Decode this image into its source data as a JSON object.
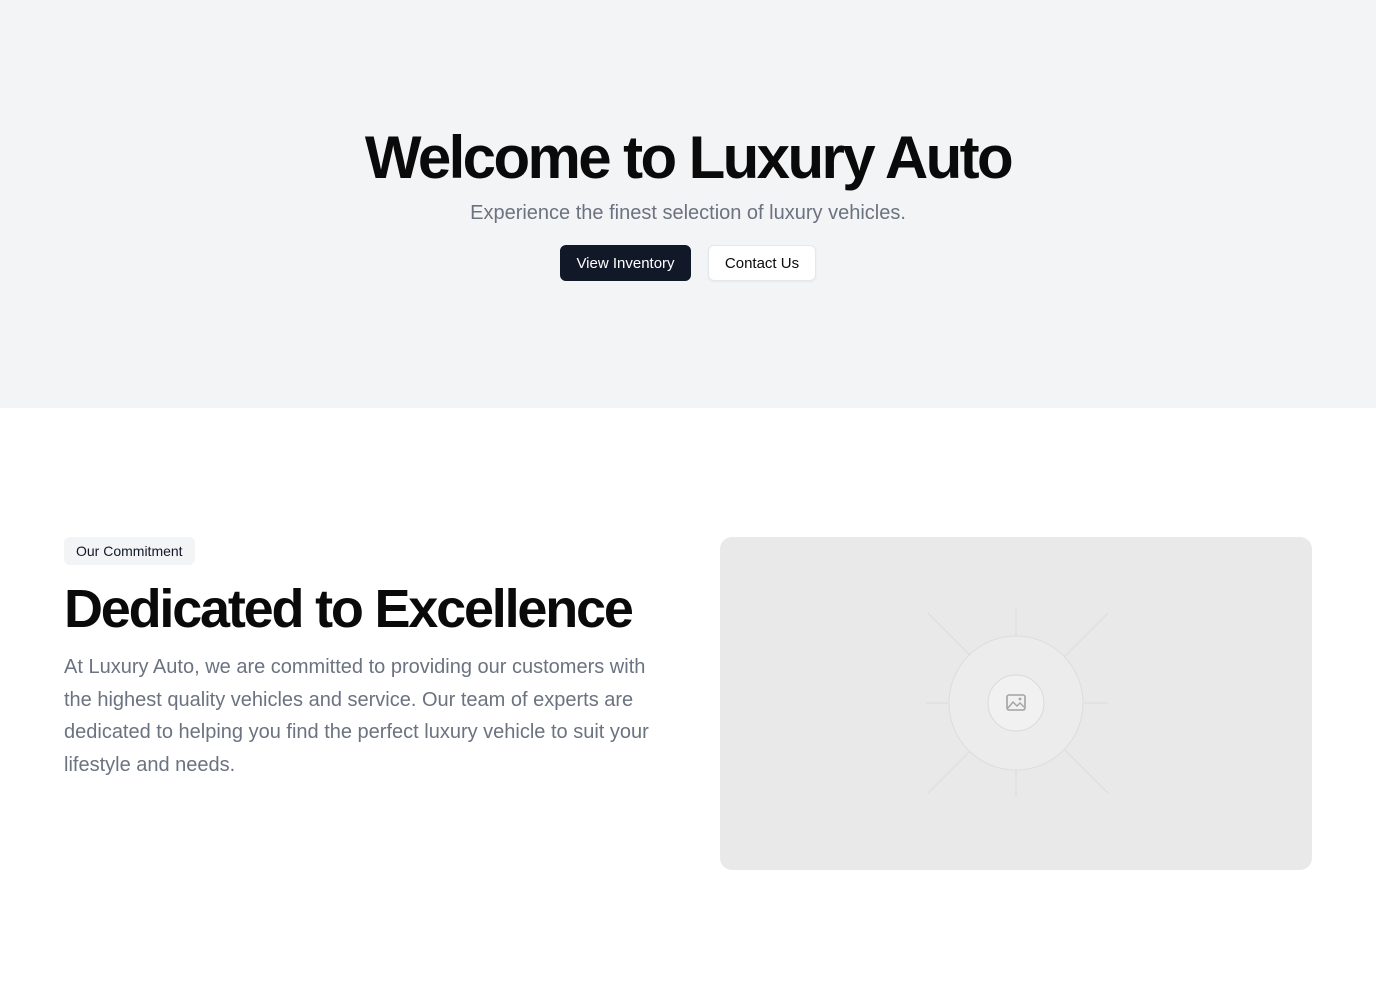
{
  "hero": {
    "title": "Welcome to Luxury Auto",
    "subtitle": "Experience the finest selection of luxury vehicles.",
    "primary_button": "View Inventory",
    "secondary_button": "Contact Us"
  },
  "commitment": {
    "badge": "Our Commitment",
    "title": "Dedicated to Excellence",
    "text": "At Luxury Auto, we are committed to providing our customers with the highest quality vehicles and service. Our team of experts are dedicated to helping you find the perfect luxury vehicle to suit your lifestyle and needs.",
    "image_icon": "image-icon"
  },
  "colors": {
    "hero_background": "#f3f4f6",
    "primary_button": "#111827",
    "muted_text": "#6b7280",
    "placeholder_background": "#e9e9e9"
  }
}
